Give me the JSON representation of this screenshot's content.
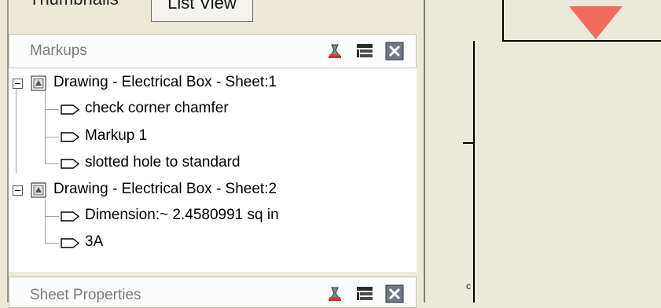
{
  "tabs": {
    "thumbnails": "Thumbnails",
    "list_view": "List View"
  },
  "markups_panel": {
    "title": "Markups",
    "icons": [
      "stamp-icon",
      "list-options-icon",
      "close-icon"
    ]
  },
  "tree": {
    "groups": [
      {
        "label": "Drawing - Electrical Box - Sheet:1",
        "items": [
          "check corner chamfer",
          "Markup 1",
          "slotted hole to standard"
        ]
      },
      {
        "label": "Drawing - Electrical Box - Sheet:2",
        "items": [
          "Dimension:~ 2.4580991 sq in",
          "3A"
        ]
      }
    ]
  },
  "sheet_properties": {
    "title": "Sheet Properties"
  },
  "drawing": {
    "corner_label": "c",
    "marker_color": "#f36b5c",
    "line_color": "#000000"
  },
  "colors": {
    "panel_bg": "#ece9d8",
    "drawing_bg": "#ebe9d8"
  }
}
